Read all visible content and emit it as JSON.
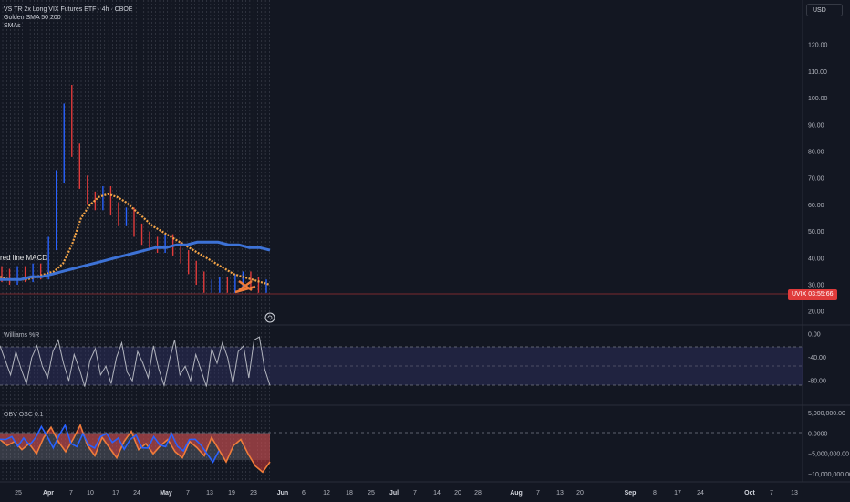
{
  "legend": {
    "symbol_line": "VS TR 2x Long VIX Futures ETF · 4h · CBOE",
    "indicator1": "Golden SMA 50 200",
    "indicator2": "SMAs"
  },
  "currency": "USD",
  "overlay_label": "red line MACD",
  "price_tag": "UVIX 03:55:66",
  "pane_titles": {
    "williams": "Williams %R",
    "obv": "OBV OSC 0.1"
  },
  "colors": {
    "background": "#131722",
    "price_red": "#e03b3b",
    "price_blue": "#2962ff",
    "sma_orange": "#f5a547",
    "sma_blue": "#3d72d6",
    "williams_line": "#b2b5be",
    "obv_orange": "#f07c3a",
    "obv_blue": "#2962ff",
    "band_fill": "#2b2e5a"
  },
  "chart_data": [
    {
      "type": "line",
      "title": "VS TR 2x Long VIX Futures ETF · 4h · CBOE",
      "ylim": [
        17,
        130
      ],
      "y_ticks": [
        "120.00",
        "110.00",
        "100.00",
        "90.00",
        "80.00",
        "70.00",
        "60.00",
        "50.00",
        "40.00",
        "30.00",
        "20.00"
      ],
      "x_ticks": [
        "25",
        "Apr",
        "7",
        "10",
        "17",
        "24",
        "May",
        "7",
        "13",
        "19",
        "23",
        "Jun",
        "6",
        "12",
        "18",
        "25",
        "Jul",
        "7",
        "14",
        "20",
        "28",
        "Aug",
        "7",
        "13",
        "20",
        "Sep",
        "8",
        "17",
        "24",
        "Oct",
        "7",
        "13"
      ],
      "series": [
        {
          "name": "Golden SMA 50 200",
          "values": [
            33,
            32,
            32,
            32,
            33,
            34,
            35,
            38,
            45,
            55,
            60,
            63,
            64,
            63,
            61,
            58,
            55,
            52,
            50,
            48,
            46,
            44,
            42,
            40,
            38,
            36,
            34,
            33,
            32,
            31,
            30
          ]
        },
        {
          "name": "SMAs",
          "values": [
            32,
            32,
            32,
            33,
            33,
            34,
            35,
            36,
            37,
            38,
            39,
            40,
            41,
            42,
            43,
            44,
            44,
            45,
            45,
            46,
            46,
            46,
            45,
            45,
            44,
            44,
            43
          ]
        }
      ],
      "price_approx": [
        34,
        33,
        32,
        34,
        33,
        35,
        34,
        45,
        70,
        95,
        80,
        68,
        62,
        60,
        64,
        58,
        54,
        56,
        50,
        47,
        45,
        44,
        46,
        43,
        40,
        36,
        32,
        29,
        29,
        30,
        29,
        31,
        32,
        30,
        29
      ],
      "last_price_level": 29
    },
    {
      "type": "line",
      "title": "Williams %R",
      "ylim": [
        -100,
        0
      ],
      "y_ticks": [
        "0.00",
        "-40.00",
        "-80.00"
      ],
      "series": [
        {
          "name": "Williams %R",
          "values": [
            -20,
            -45,
            -70,
            -30,
            -60,
            -85,
            -40,
            -20,
            -55,
            -75,
            -30,
            -10,
            -50,
            -80,
            -35,
            -60,
            -90,
            -45,
            -25,
            -70,
            -55,
            -85,
            -40,
            -15,
            -65,
            -80,
            -30,
            -50,
            -75,
            -20,
            -60,
            -88,
            -45,
            -10,
            -70,
            -55,
            -80,
            -35,
            -62,
            -90,
            -25,
            -50,
            -15,
            -40,
            -85,
            -30,
            -20,
            -75,
            -10,
            -5,
            -60,
            -88
          ]
        }
      ],
      "bands": [
        -20,
        -80
      ]
    },
    {
      "type": "area",
      "title": "OBV OSC 0.1",
      "ylim": [
        -11000000,
        6000000
      ],
      "y_ticks": [
        "5,000,000.00",
        "0.0000",
        "−5,000,000.00",
        "−10,000,000.00"
      ],
      "series": [
        {
          "name": "OBV OSC 0.1",
          "values": [
            -1500000,
            -3000000,
            -2000000,
            -4000000,
            -2500000,
            -5000000,
            -1000000,
            1500000,
            -2000000,
            -4500000,
            -1500000,
            2000000,
            -3000000,
            -5500000,
            -1000000,
            -3500000,
            -6000000,
            -2000000,
            500000,
            -4000000,
            -2500000,
            -5000000,
            -3000000,
            -1500000,
            -4500000,
            -6000000,
            -2000000,
            -3500000,
            -5500000,
            -1000000,
            -4000000,
            -7000000,
            -3000000,
            -1500000,
            -5000000,
            -8000000,
            -9500000,
            -7000000
          ]
        }
      ]
    }
  ]
}
